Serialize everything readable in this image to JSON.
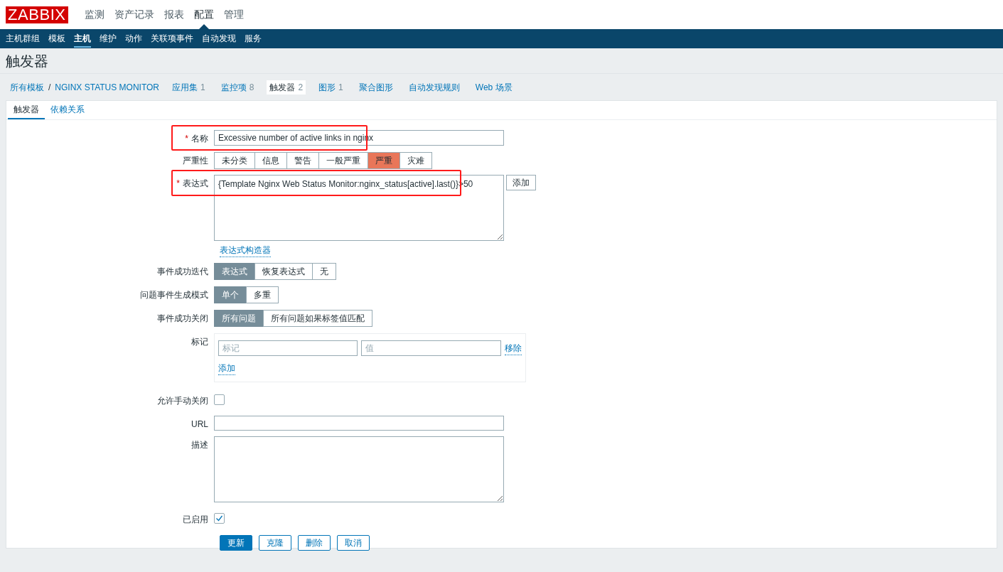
{
  "logo": "ZABBIX",
  "main_menu": [
    {
      "label": "监测",
      "selected": false
    },
    {
      "label": "资产记录",
      "selected": false
    },
    {
      "label": "报表",
      "selected": false
    },
    {
      "label": "配置",
      "selected": true
    },
    {
      "label": "管理",
      "selected": false
    }
  ],
  "sub_menu": [
    {
      "label": "主机群组",
      "selected": false
    },
    {
      "label": "模板",
      "selected": false
    },
    {
      "label": "主机",
      "selected": true
    },
    {
      "label": "维护",
      "selected": false
    },
    {
      "label": "动作",
      "selected": false
    },
    {
      "label": "关联项事件",
      "selected": false
    },
    {
      "label": "自动发现",
      "selected": false
    },
    {
      "label": "服务",
      "selected": false
    }
  ],
  "page_title": "触发器",
  "breadcrumb": {
    "root": "所有模板",
    "separator": "/",
    "current": "NGINX STATUS MONITOR"
  },
  "entity_tabs": [
    {
      "label": "应用集",
      "count": "1",
      "selected": false
    },
    {
      "label": "监控项",
      "count": "8",
      "selected": false
    },
    {
      "label": "触发器",
      "count": "2",
      "selected": true
    },
    {
      "label": "图形",
      "count": "1",
      "selected": false
    },
    {
      "label": "聚合图形",
      "selected": false
    },
    {
      "label": "自动发现规则",
      "selected": false
    },
    {
      "label": "Web 场景",
      "selected": false
    }
  ],
  "form_tabs": [
    {
      "label": "触发器",
      "selected": true
    },
    {
      "label": "依赖关系",
      "selected": false
    }
  ],
  "name": {
    "label": "名称",
    "required_mark": "*",
    "value": "Excessive number of active links in nginx",
    "highlighted": true
  },
  "severity": {
    "label": "严重性",
    "options": [
      {
        "label": "未分类",
        "selected": false
      },
      {
        "label": "信息",
        "selected": false
      },
      {
        "label": "警告",
        "selected": false
      },
      {
        "label": "一般严重",
        "selected": false
      },
      {
        "label": "严重",
        "selected": true
      },
      {
        "label": "灾难",
        "selected": false
      }
    ]
  },
  "expression": {
    "label": "表达式",
    "required_mark": "*",
    "value": "{Template Nginx Web Status Monitor:nginx_status[active].last()}>50",
    "highlighted": true,
    "add_button": "添加",
    "builder_link": "表达式构造器"
  },
  "ok_event_generation": {
    "label": "事件成功迭代",
    "options": [
      {
        "label": "表达式",
        "selected": true
      },
      {
        "label": "恢复表达式",
        "selected": false
      },
      {
        "label": "无",
        "selected": false
      }
    ]
  },
  "problem_mode": {
    "label": "问题事件生成模式",
    "options": [
      {
        "label": "单个",
        "selected": true
      },
      {
        "label": "多重",
        "selected": false
      }
    ]
  },
  "ok_close": {
    "label": "事件成功关闭",
    "options": [
      {
        "label": "所有问题",
        "selected": true
      },
      {
        "label": "所有问题如果标签值匹配",
        "selected": false
      }
    ]
  },
  "tags": {
    "label": "标记",
    "rows": [
      {
        "tag_placeholder": "标记",
        "value_placeholder": "值",
        "remove": "移除"
      }
    ],
    "add": "添加"
  },
  "manual_close": {
    "label": "允许手动关闭",
    "checked": false
  },
  "url": {
    "label": "URL"
  },
  "description": {
    "label": "描述"
  },
  "enabled": {
    "label": "已启用",
    "checked": true
  },
  "buttons": [
    {
      "label": "更新",
      "kind": "primary"
    },
    {
      "label": "克隆",
      "kind": "secondary"
    },
    {
      "label": "删除",
      "kind": "secondary"
    },
    {
      "label": "取消",
      "kind": "secondary"
    }
  ]
}
